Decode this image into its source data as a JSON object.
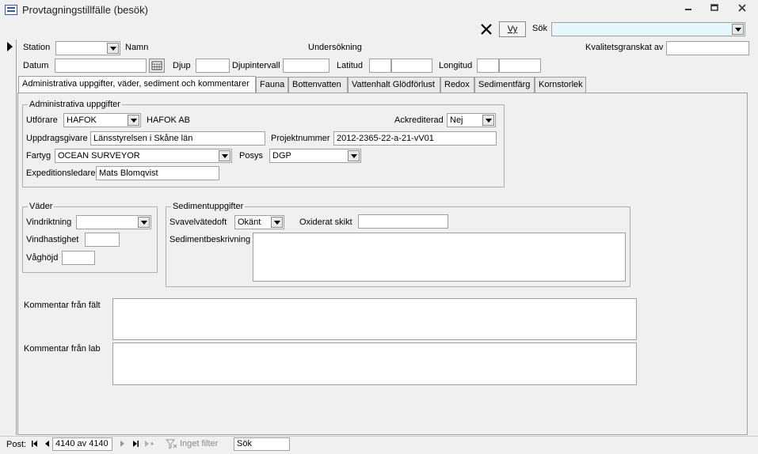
{
  "window": {
    "title": "Provtagningstillfälle (besök)",
    "minimize": "▭",
    "restore": "◻",
    "close": "✕"
  },
  "toolbar": {
    "clear_icon": "✕",
    "vy_label": "Vy",
    "search_label": "Sök",
    "search_value": ""
  },
  "header": {
    "station_label": "Station",
    "station_value": "",
    "namn_label": "Namn",
    "undersokning_label": "Undersökning",
    "kvalitet_label": "Kvalitetsgranskat av",
    "kvalitet_value": "",
    "datum_label": "Datum",
    "datum_value": "",
    "djup_label": "Djup",
    "djup_value": "",
    "djupintervall_label": "Djupintervall",
    "djupintervall_value": "",
    "latitud_label": "Latitud",
    "longitud_label": "Longitud"
  },
  "tabs": [
    {
      "label": "Administrativa uppgifter, väder, sediment och kommentarer"
    },
    {
      "label": "Fauna"
    },
    {
      "label": "Bottenvatten"
    },
    {
      "label": "Vattenhalt Glödförlust"
    },
    {
      "label": "Redox"
    },
    {
      "label": "Sedimentfärg"
    },
    {
      "label": "Kornstorlek"
    }
  ],
  "admin": {
    "group_title": "Administrativa uppgifter",
    "utforare_label": "Utförare",
    "utforare_value": "HAFOK",
    "utforare_name": "HAFOK AB",
    "ackrediterad_label": "Ackrediterad",
    "ackrediterad_value": "Nej",
    "uppdragsgivare_label": "Uppdragsgivare",
    "uppdragsgivare_value": "Länsstyrelsen i Skåne län",
    "projektnummer_label": "Projektnummer",
    "projektnummer_value": "2012-2365-22-a-21-vV01",
    "fartyg_label": "Fartyg",
    "fartyg_value": "OCEAN SURVEYOR",
    "posys_label": "Posys",
    "posys_value": "DGP",
    "expeditionsledare_label": "Expeditionsledare",
    "expeditionsledare_value": "Mats Blomqvist"
  },
  "vader": {
    "group_title": "Väder",
    "vindriktning_label": "Vindriktning",
    "vindhastighet_label": "Vindhastighet",
    "vaghojd_label": "Våghöjd"
  },
  "sediment": {
    "group_title": "Sedimentuppgifter",
    "svavel_label": "Svavelvätedoft",
    "svavel_value": "Okänt",
    "oxiderat_label": "Oxiderat skikt",
    "beskrivning_label": "Sedimentbeskrivning"
  },
  "comments": {
    "falt_label": "Kommentar från fält",
    "lab_label": "Kommentar från lab"
  },
  "status": {
    "post_label": "Post:",
    "record_value": "4140 av 4140",
    "filter_label": "Inget filter",
    "search_label": "Sök"
  }
}
